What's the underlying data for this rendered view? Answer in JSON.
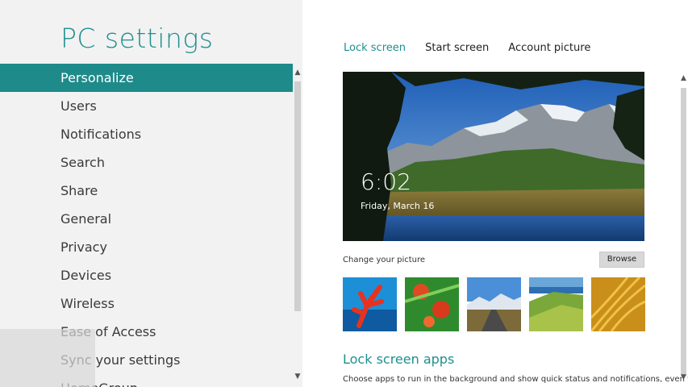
{
  "app": {
    "title": "PC settings"
  },
  "nav": {
    "items": [
      {
        "label": "Personalize"
      },
      {
        "label": "Users"
      },
      {
        "label": "Notifications"
      },
      {
        "label": "Search"
      },
      {
        "label": "Share"
      },
      {
        "label": "General"
      },
      {
        "label": "Privacy"
      },
      {
        "label": "Devices"
      },
      {
        "label": "Wireless"
      },
      {
        "label": "Ease of Access"
      },
      {
        "label": "Sync your settings"
      },
      {
        "label": "HomeGroup"
      }
    ],
    "active_index": 0
  },
  "tabs": {
    "items": [
      {
        "label": "Lock screen"
      },
      {
        "label": "Start screen"
      },
      {
        "label": "Account picture"
      }
    ],
    "active_index": 0
  },
  "lockscreen": {
    "time": "6:02",
    "date": "Friday, March 16",
    "change_label": "Change your picture",
    "browse_label": "Browse"
  },
  "apps_section": {
    "title": "Lock screen apps",
    "description": "Choose apps to run in the background and show quick status and notifications, even when"
  },
  "colors": {
    "accent": "#1e8a8a",
    "left_panel_bg": "#f2f2f2"
  }
}
